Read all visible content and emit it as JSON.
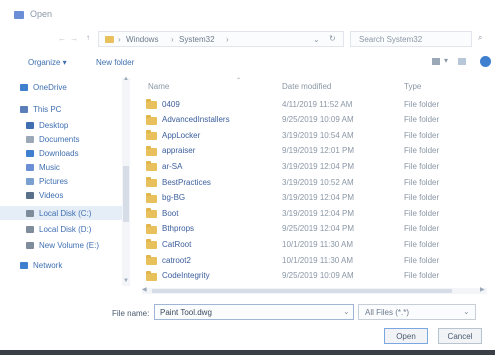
{
  "window": {
    "title": "Open"
  },
  "address": {
    "path": [
      "Windows",
      "System32"
    ],
    "search_placeholder": "Search System32"
  },
  "toolbar": {
    "organize": "Organize ▾",
    "new_folder": "New folder"
  },
  "columns": {
    "name": "Name",
    "date": "Date modified",
    "type": "Type"
  },
  "sidebar": {
    "items": [
      {
        "label": "OneDrive",
        "icon": "cloud-icon"
      },
      {
        "label": "This PC",
        "icon": "computer-icon"
      },
      {
        "label": "Desktop",
        "icon": "desktop-icon"
      },
      {
        "label": "Documents",
        "icon": "documents-icon"
      },
      {
        "label": "Downloads",
        "icon": "download-icon"
      },
      {
        "label": "Music",
        "icon": "music-icon"
      },
      {
        "label": "Pictures",
        "icon": "pictures-icon"
      },
      {
        "label": "Videos",
        "icon": "videos-icon"
      },
      {
        "label": "Local Disk (C:)",
        "icon": "drive-icon"
      },
      {
        "label": "Local Disk (D:)",
        "icon": "drive-icon"
      },
      {
        "label": "New Volume (E:)",
        "icon": "drive-icon"
      },
      {
        "label": "Network",
        "icon": "network-icon"
      }
    ]
  },
  "files": [
    {
      "name": "0409",
      "date": "4/11/2019 11:52 AM",
      "type": "File folder"
    },
    {
      "name": "AdvancedInstallers",
      "date": "9/25/2019 10:09 AM",
      "type": "File folder"
    },
    {
      "name": "AppLocker",
      "date": "3/19/2019 10:54 AM",
      "type": "File folder"
    },
    {
      "name": "appraiser",
      "date": "9/19/2019 12:01 PM",
      "type": "File folder"
    },
    {
      "name": "ar-SA",
      "date": "3/19/2019 12:04 PM",
      "type": "File folder"
    },
    {
      "name": "BestPractices",
      "date": "3/19/2019 10:52 AM",
      "type": "File folder"
    },
    {
      "name": "bg-BG",
      "date": "3/19/2019 12:04 PM",
      "type": "File folder"
    },
    {
      "name": "Boot",
      "date": "3/19/2019 12:04 PM",
      "type": "File folder"
    },
    {
      "name": "Bthprops",
      "date": "9/25/2019 12:04 PM",
      "type": "File folder"
    },
    {
      "name": "CatRoot",
      "date": "10/1/2019 11:30 AM",
      "type": "File folder"
    },
    {
      "name": "catroot2",
      "date": "10/1/2019 11:30 AM",
      "type": "File folder"
    },
    {
      "name": "CodeIntegrity",
      "date": "9/25/2019 10:09 AM",
      "type": "File folder"
    }
  ],
  "footer": {
    "file_name_label": "File name:",
    "file_name_value": "Paint Tool.dwg",
    "filter": "All Files (*.*)",
    "open_label": "Open",
    "cancel_label": "Cancel"
  }
}
